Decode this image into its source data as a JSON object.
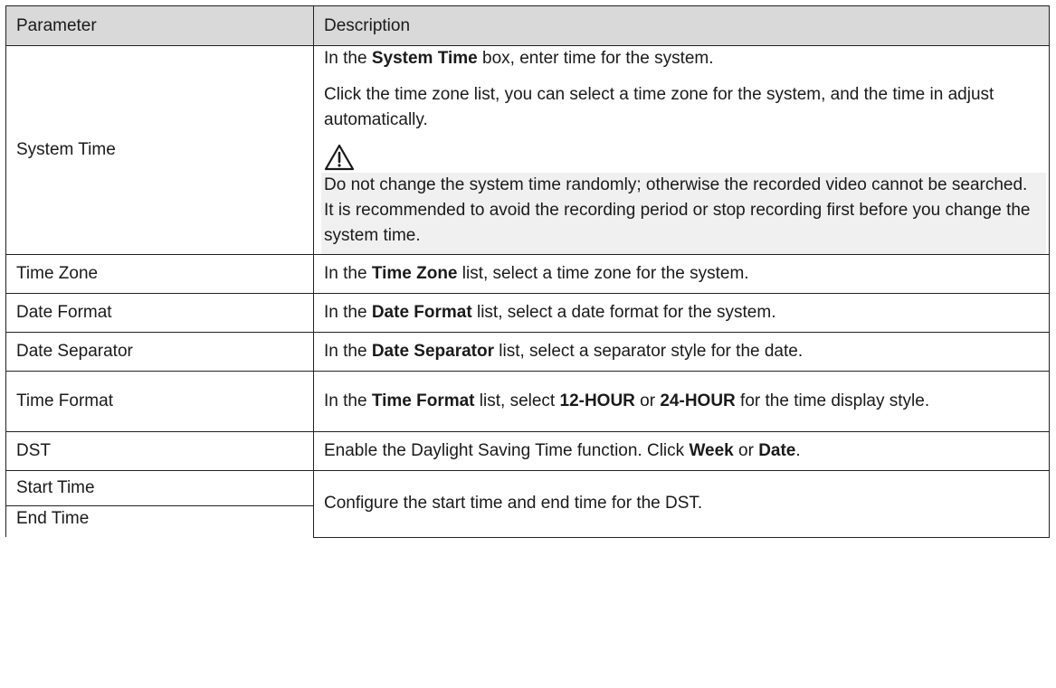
{
  "table": {
    "headers": {
      "parameter": "Parameter",
      "description": "Description"
    },
    "system_time": {
      "param": "System Time",
      "d1_pre": "In the ",
      "d1_bold": "System Time",
      "d1_post": "  box, enter time for the system.",
      "d2": "Click the time zone list, you can select a time zone for the system, and the time in adjust automatically.",
      "warning_icon": "warning-triangle-icon",
      "note": "Do not change the system time randomly; otherwise the recorded video cannot be searched. It is recommended to avoid the recording period or stop recording first before you change the system time."
    },
    "time_zone": {
      "param": "Time Zone",
      "pre": "In the ",
      "bold": "Time Zone",
      "post": "  list, select a time zone for the system."
    },
    "date_format": {
      "param": "Date Format",
      "pre": "In the ",
      "bold": "Date Format",
      "post": "  list, select a date format for the system."
    },
    "date_separator": {
      "param": "Date Separator",
      "pre": "In the ",
      "bold": "Date Separator",
      "post": "  list, select a separator style for the date."
    },
    "time_format": {
      "param": "Time Format",
      "pre": "In the ",
      "bold": "Time Format",
      "mid1": "  list, select ",
      "bold2": "12-HOUR",
      "mid2": " or ",
      "bold3": "24-HOUR",
      "post": " for the time display style."
    },
    "dst": {
      "param": "DST",
      "pre": "Enable the Daylight Saving Time function. Click ",
      "bold1": "Week",
      "mid": "  or ",
      "bold2": "Date",
      "post": "."
    },
    "start_time": {
      "param": "Start Time"
    },
    "end_time": {
      "param": "End Time"
    },
    "start_end_desc": "Configure the start time and end time for the DST."
  }
}
